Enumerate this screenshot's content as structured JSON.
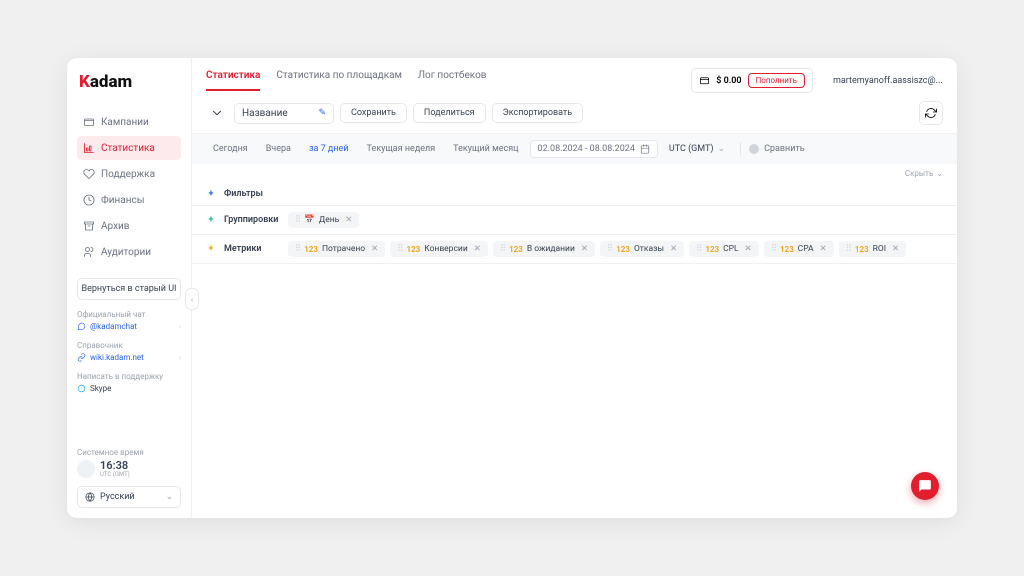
{
  "logo": {
    "part1": "K",
    "part2": "adam"
  },
  "sidebar": {
    "items": [
      {
        "label": "Кампании",
        "icon": "folder"
      },
      {
        "label": "Статистика",
        "icon": "chart",
        "active": true
      },
      {
        "label": "Поддержка",
        "icon": "heart"
      },
      {
        "label": "Финансы",
        "icon": "clock"
      },
      {
        "label": "Архив",
        "icon": "archive"
      },
      {
        "label": "Аудитории",
        "icon": "users"
      }
    ],
    "back_to_old": "Вернуться в старый UI",
    "chat": {
      "title": "Официальный чат",
      "handle": "@kadamchat"
    },
    "help": {
      "title": "Справочник",
      "link": "wiki.kadam.net"
    },
    "support": {
      "title": "Написать в поддержку",
      "skype": "Skype"
    },
    "time": {
      "title": "Системное время",
      "value": "16:38",
      "tz": "UTC (GMT)"
    },
    "lang": "Русский"
  },
  "header": {
    "tabs": [
      {
        "label": "Статистика",
        "active": true
      },
      {
        "label": "Статистика по площадкам"
      },
      {
        "label": "Лог постбеков"
      }
    ],
    "balance": "$ 0.00",
    "topup": "Пополнить",
    "user": "martemyanoff.aassiszc@..."
  },
  "toolbar": {
    "name_placeholder": "Название",
    "save": "Сохранить",
    "share": "Поделиться",
    "export": "Экспортировать"
  },
  "dates": {
    "pills": [
      "Сегодня",
      "Вчера",
      "за 7 дней",
      "Текущая неделя",
      "Текущий месяц"
    ],
    "active_index": 2,
    "range": "02.08.2024 - 08.08.2024",
    "tz": "UTC (GMT)",
    "compare": "Сравнить"
  },
  "hide_label": "Скрыть",
  "sections": {
    "filters": "Фильтры",
    "groups": "Группировки",
    "groups_chips": [
      {
        "label": "День",
        "type": "calendar"
      }
    ],
    "metrics": "Метрики",
    "metrics_chips": [
      {
        "num": "123",
        "label": "Потрачено"
      },
      {
        "num": "123",
        "label": "Конверсии"
      },
      {
        "num": "123",
        "label": "В ожидании"
      },
      {
        "num": "123",
        "label": "Отказы"
      },
      {
        "num": "123",
        "label": "CPL"
      },
      {
        "num": "123",
        "label": "CPA"
      },
      {
        "num": "123",
        "label": "ROI"
      }
    ]
  }
}
